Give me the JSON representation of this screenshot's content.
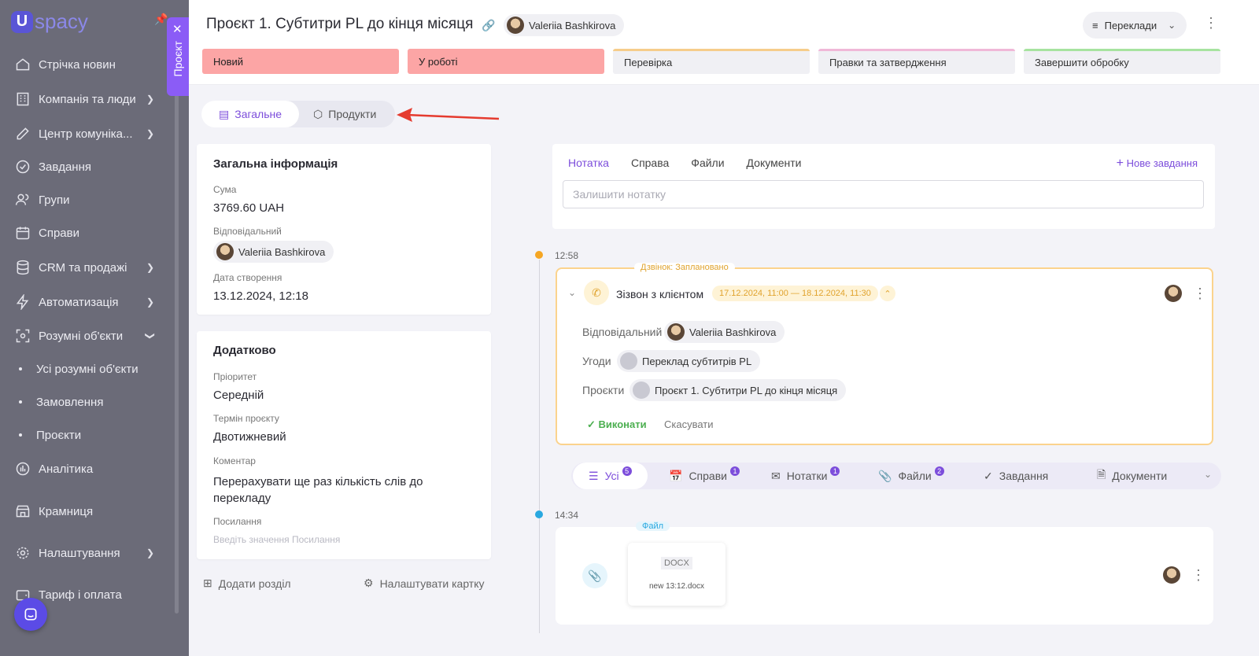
{
  "sidebar": {
    "logo": {
      "u": "U",
      "rest": "spacy"
    },
    "items": [
      {
        "label": "Стрічка новин"
      },
      {
        "label": "Компанія та люди"
      },
      {
        "label": "Центр комуніка..."
      },
      {
        "label": "Завдання"
      },
      {
        "label": "Групи"
      },
      {
        "label": "Справи"
      },
      {
        "label": "CRM та продажі"
      },
      {
        "label": "Автоматизація"
      },
      {
        "label": "Розумні об'єкти"
      },
      {
        "label": "Усі розумні об'єкти"
      },
      {
        "label": "Замовлення"
      },
      {
        "label": "Проєкти"
      },
      {
        "label": "Аналітика"
      },
      {
        "label": "Крамниця"
      },
      {
        "label": "Налаштування"
      },
      {
        "label": "Тариф і оплата"
      }
    ],
    "panel_tab": "Проєкт"
  },
  "header": {
    "title": "Проєкт 1. Субтитри PL до кінця місяця",
    "user": "Valeriia Bashkirova",
    "translations": "Переклади",
    "stages": [
      {
        "label": "Новий",
        "color": "#fca5a5"
      },
      {
        "label": "У роботі",
        "color": "#fca5a5"
      },
      {
        "label": "Перевірка",
        "color": "#f6cd8b"
      },
      {
        "label": "Правки та затвердження",
        "color": "#f0b8d8"
      },
      {
        "label": "Завершити обробку",
        "color": "#a7e3a0"
      }
    ]
  },
  "tabs": {
    "general": "Загальне",
    "products": "Продукти"
  },
  "general_info": {
    "title": "Загальна інформація",
    "sum_label": "Сума",
    "sum_value": "3769.60 UAH",
    "resp_label": "Відповідальний",
    "resp_value": "Valeriia Bashkirova",
    "created_label": "Дата створення",
    "created_value": "13.12.2024, 12:18"
  },
  "additional": {
    "title": "Додатково",
    "priority_label": "Пріоритет",
    "priority_value": "Середній",
    "term_label": "Термін проєкту",
    "term_value": "Двотижневий",
    "comment_label": "Коментар",
    "comment_value": "Перерахувати ще раз кількість слів до перекладу",
    "link_label": "Посилання",
    "link_placeholder": "Введіть значення Посилання"
  },
  "footer": {
    "add_section": "Додати розділ",
    "configure_card": "Налаштувати картку"
  },
  "note_panel": {
    "tabs": [
      "Нотатка",
      "Справа",
      "Файли",
      "Документи"
    ],
    "new_task": "Нове завдання",
    "placeholder": "Залишити нотатку"
  },
  "timeline": {
    "time1": "12:58",
    "time2": "14:34",
    "call": {
      "badge": "Дзвінок: Заплановано",
      "title": "Зізвон з клієнтом",
      "dates": "17.12.2024, 11:00 — 18.12.2024, 11:30",
      "resp_label": "Відповідальний",
      "resp_value": "Valeriia Bashkirova",
      "deals_label": "Угоди",
      "deals_value": "Переклад субтитрів PL",
      "projects_label": "Проєкти",
      "projects_value": "Проєкт 1. Субтитри PL до кінця місяця",
      "done": "Виконати",
      "cancel": "Скасувати"
    },
    "filters": [
      {
        "label": "Усі",
        "count": "5"
      },
      {
        "label": "Справи",
        "count": "1"
      },
      {
        "label": "Нотатки",
        "count": "1"
      },
      {
        "label": "Файли",
        "count": "2"
      },
      {
        "label": "Завдання",
        "count": ""
      },
      {
        "label": "Документи",
        "count": ""
      }
    ],
    "file": {
      "badge": "Файл",
      "ext": "DOCX",
      "name": "new 13:12.docx"
    }
  },
  "colors": {
    "accent": "#7c4ddb",
    "warning": "#f5a623",
    "info": "#29a8e0"
  }
}
